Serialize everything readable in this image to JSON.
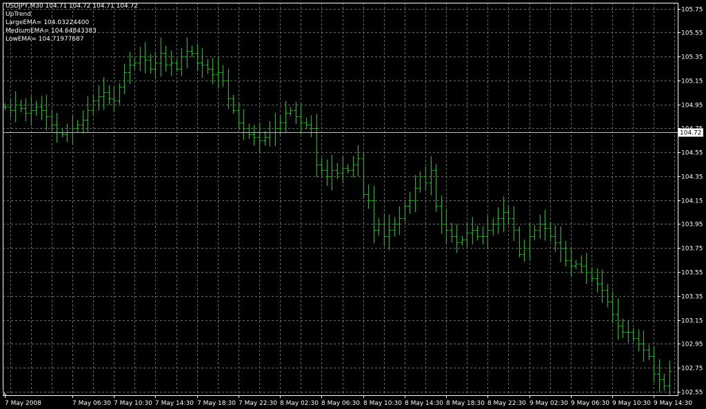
{
  "info": {
    "header": "USDJPY,M30  104.71 104.72 104.71 104.72",
    "trend": "UpTrend",
    "large_ema": "LargeEMA= 104.03224400",
    "medium_ema": "MediumEMA= 104.64843383",
    "low_ema": "LowEMA= 104.71977687"
  },
  "colors": {
    "background": "#000000",
    "grid": "#6b6b6b",
    "bars": "#00d000",
    "axis_text": "#ffffff",
    "price_line": "#c0c0c0",
    "price_label_bg": "#ffffff",
    "price_label_text": "#000000"
  },
  "chart_data": {
    "type": "ohlc",
    "symbol": "USDJPY",
    "timeframe": "M30",
    "ylim": [
      102.52,
      105.8
    ],
    "yticks": [
      105.75,
      105.55,
      105.35,
      105.15,
      104.95,
      104.75,
      104.55,
      104.35,
      104.15,
      103.95,
      103.75,
      103.55,
      103.35,
      103.15,
      102.95,
      102.75,
      102.55
    ],
    "xticks": [
      {
        "label": "7 May 2008",
        "bar": 0
      },
      {
        "label": "7 May 06:30",
        "bar": 13
      },
      {
        "label": "7 May 10:30",
        "bar": 21
      },
      {
        "label": "7 May 14:30",
        "bar": 29
      },
      {
        "label": "7 May 18:30",
        "bar": 37
      },
      {
        "label": "7 May 22:30",
        "bar": 45
      },
      {
        "label": "8 May 02:30",
        "bar": 53
      },
      {
        "label": "8 May 06:30",
        "bar": 61
      },
      {
        "label": "8 May 10:30",
        "bar": 69
      },
      {
        "label": "8 May 14:30",
        "bar": 77
      },
      {
        "label": "8 May 18:30",
        "bar": 85
      },
      {
        "label": "8 May 22:30",
        "bar": 93
      },
      {
        "label": "9 May 02:30",
        "bar": 101
      },
      {
        "label": "9 May 06:30",
        "bar": 109
      },
      {
        "label": "9 May 10:30",
        "bar": 117
      },
      {
        "label": "9 May 14:30",
        "bar": 125
      }
    ],
    "current_price": 104.72,
    "grid": true,
    "closes": [
      104.93,
      104.9,
      104.95,
      104.92,
      104.88,
      104.9,
      104.93,
      104.9,
      104.85,
      104.78,
      104.72,
      104.7,
      104.72,
      104.75,
      104.78,
      104.82,
      104.9,
      104.98,
      105.02,
      105.05,
      105.0,
      104.98,
      105.1,
      105.22,
      105.28,
      105.3,
      105.35,
      105.32,
      105.25,
      105.3,
      105.38,
      105.28,
      105.3,
      105.25,
      105.35,
      105.4,
      105.38,
      105.3,
      105.28,
      105.25,
      105.2,
      105.22,
      105.15,
      105.0,
      104.9,
      104.8,
      104.75,
      104.7,
      104.68,
      104.65,
      104.68,
      104.72,
      104.75,
      104.8,
      104.88,
      104.9,
      104.85,
      104.8,
      104.78,
      104.75,
      104.45,
      104.4,
      104.35,
      104.4,
      104.38,
      104.42,
      104.4,
      104.45,
      104.5,
      104.2,
      104.15,
      103.9,
      103.95,
      103.85,
      103.9,
      103.95,
      104.0,
      104.1,
      104.15,
      104.25,
      104.35,
      104.3,
      104.4,
      104.1,
      103.95,
      103.9,
      103.85,
      103.8,
      103.82,
      103.88,
      103.9,
      103.85,
      103.85,
      103.9,
      103.95,
      104.0,
      104.05,
      104.0,
      103.9,
      103.7,
      103.75,
      103.85,
      103.9,
      103.95,
      103.92,
      103.85,
      103.8,
      103.75,
      103.65,
      103.6,
      103.62,
      103.6,
      103.55,
      103.5,
      103.45,
      103.4,
      103.3,
      103.2,
      103.1,
      103.05,
      103.05,
      103.0,
      102.95,
      102.9,
      102.85,
      102.7,
      102.65,
      102.6,
      102.72
    ]
  }
}
